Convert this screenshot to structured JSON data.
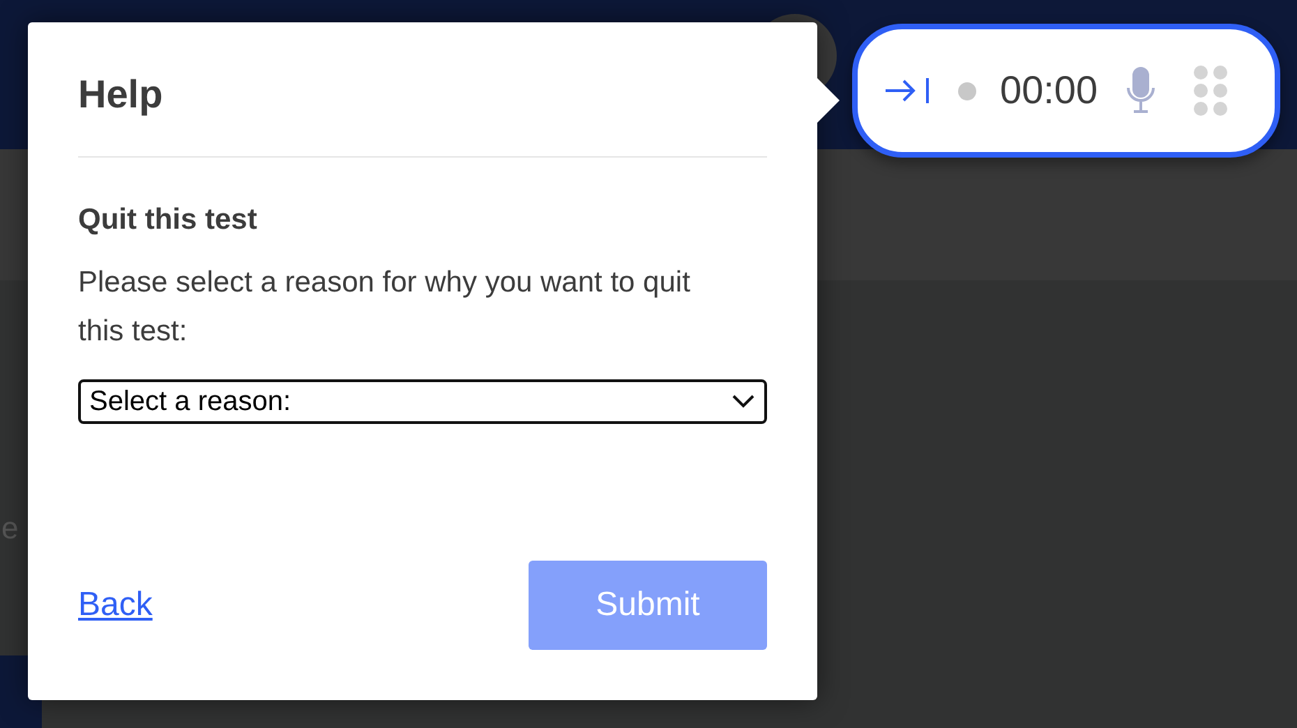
{
  "background": {
    "partial_text": "e"
  },
  "dialog": {
    "title": "Help",
    "heading": "Quit this test",
    "prompt": "Please select a reason for why you want to quit this test:",
    "select": {
      "value": "Select a reason:"
    },
    "back_link": "Back",
    "submit": {
      "label": "Submit",
      "disabled": true
    }
  },
  "recorder": {
    "timer": "00:00",
    "recording": false,
    "mic_on": false
  }
}
